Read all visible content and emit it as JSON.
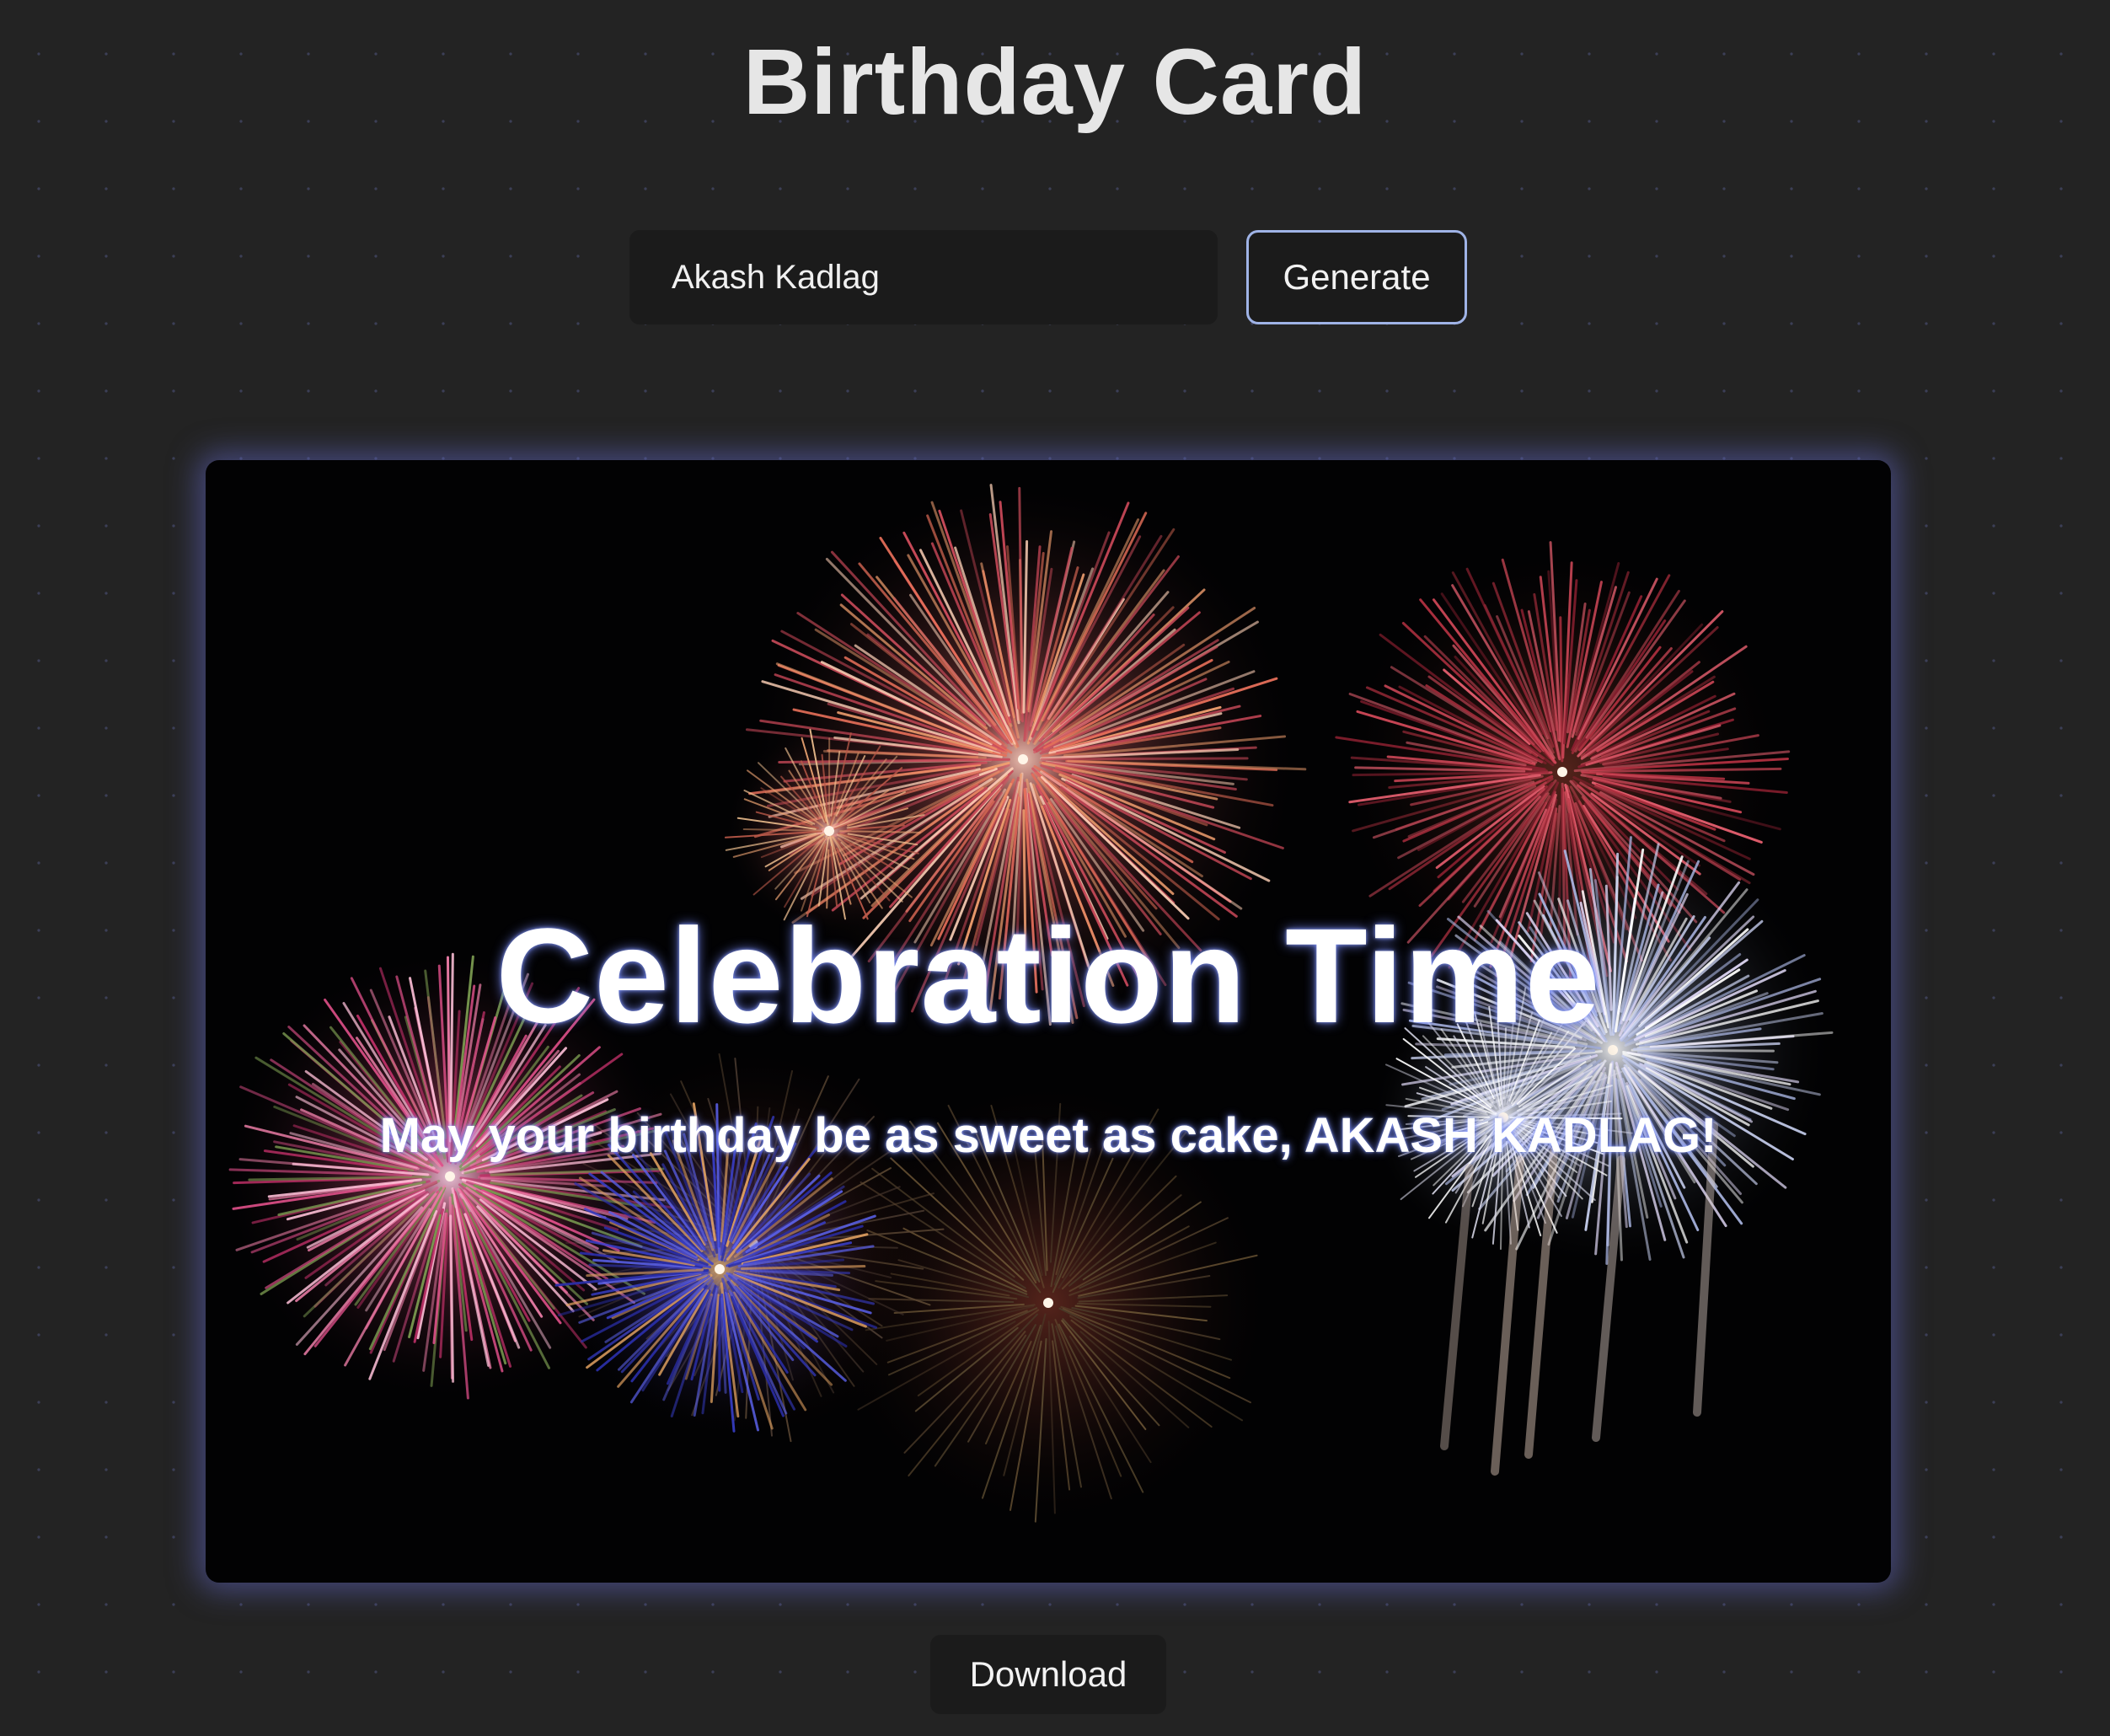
{
  "header": {
    "title": "Birthday Card"
  },
  "form": {
    "name_value": "Akash Kadlag",
    "generate_label": "Generate"
  },
  "card": {
    "heading": "Celebration Time",
    "message": "May your birthday be as sweet as cake, AKASH KADLAG!",
    "background_image": "fireworks-image",
    "glow_color": "#5f64be"
  },
  "footer": {
    "download_label": "Download"
  },
  "colors": {
    "page_background": "#232323",
    "button_border": "#9fb3e6",
    "card_background": "#020203"
  }
}
